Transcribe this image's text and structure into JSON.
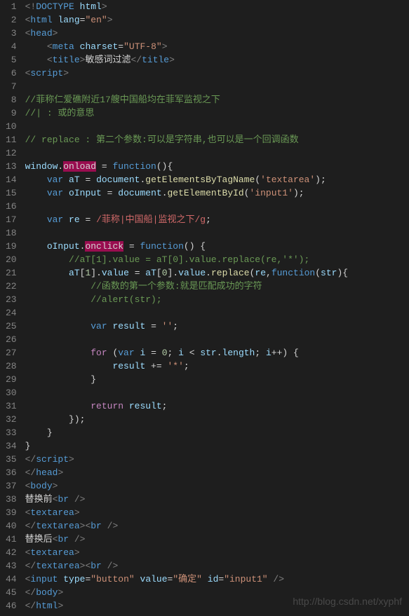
{
  "lineCount": 46,
  "watermark": "http://blog.csdn.net/xyphf",
  "tokens": {
    "l1": [
      [
        "t-gray",
        "<!"
      ],
      [
        "t-blue",
        "DOCTYPE"
      ],
      [
        "t-white",
        " "
      ],
      [
        "t-attr",
        "html"
      ],
      [
        "t-gray",
        ">"
      ]
    ],
    "l2": [
      [
        "t-gray",
        "<"
      ],
      [
        "t-blue",
        "html"
      ],
      [
        "t-white",
        " "
      ],
      [
        "t-attr",
        "lang"
      ],
      [
        "t-white",
        "="
      ],
      [
        "t-str",
        "\"en\""
      ],
      [
        "t-gray",
        ">"
      ]
    ],
    "l3": [
      [
        "t-gray",
        "<"
      ],
      [
        "t-blue",
        "head"
      ],
      [
        "t-gray",
        ">"
      ]
    ],
    "l4": [
      [
        "t-white",
        "    "
      ],
      [
        "t-gray",
        "<"
      ],
      [
        "t-blue",
        "meta"
      ],
      [
        "t-white",
        " "
      ],
      [
        "t-attr",
        "charset"
      ],
      [
        "t-white",
        "="
      ],
      [
        "t-str",
        "\"UTF-8\""
      ],
      [
        "t-gray",
        ">"
      ]
    ],
    "l5": [
      [
        "t-white",
        "    "
      ],
      [
        "t-gray",
        "<"
      ],
      [
        "t-blue",
        "title"
      ],
      [
        "t-gray",
        ">"
      ],
      [
        "t-white",
        "敏感词过滤"
      ],
      [
        "t-gray",
        "</"
      ],
      [
        "t-blue",
        "title"
      ],
      [
        "t-gray",
        ">"
      ]
    ],
    "l6": [
      [
        "t-gray",
        "<"
      ],
      [
        "t-blue",
        "script"
      ],
      [
        "t-gray",
        ">"
      ]
    ],
    "l7": [],
    "l8": [
      [
        "t-cmt",
        "//菲称仁爱礁附近17艘中国船均在菲军监视之下"
      ]
    ],
    "l9": [
      [
        "t-cmt",
        "//| : 或的意思"
      ]
    ],
    "l10": [],
    "l11": [
      [
        "t-cmt",
        "// replace : 第二个参数:可以是字符串,也可以是一个回调函数"
      ]
    ],
    "l12": [],
    "l13": [
      [
        "t-lblue",
        "window"
      ],
      [
        "t-white",
        "."
      ],
      [
        "hl",
        "onload"
      ],
      [
        "t-white",
        " = "
      ],
      [
        "t-kw",
        "function"
      ],
      [
        "t-white",
        "(){"
      ]
    ],
    "l14": [
      [
        "t-white",
        "    "
      ],
      [
        "t-kw",
        "var"
      ],
      [
        "t-white",
        " "
      ],
      [
        "t-lblue",
        "aT"
      ],
      [
        "t-white",
        " = "
      ],
      [
        "t-lblue",
        "document"
      ],
      [
        "t-white",
        "."
      ],
      [
        "t-func",
        "getElementsByTagName"
      ],
      [
        "t-white",
        "("
      ],
      [
        "t-str",
        "'textarea'"
      ],
      [
        "t-white",
        ");"
      ]
    ],
    "l15": [
      [
        "t-white",
        "    "
      ],
      [
        "t-kw",
        "var"
      ],
      [
        "t-white",
        " "
      ],
      [
        "t-lblue",
        "oInput"
      ],
      [
        "t-white",
        " = "
      ],
      [
        "t-lblue",
        "document"
      ],
      [
        "t-white",
        "."
      ],
      [
        "t-func",
        "getElementById"
      ],
      [
        "t-white",
        "("
      ],
      [
        "t-str",
        "'input1'"
      ],
      [
        "t-white",
        ");"
      ]
    ],
    "l16": [],
    "l17": [
      [
        "t-white",
        "    "
      ],
      [
        "t-kw",
        "var"
      ],
      [
        "t-white",
        " "
      ],
      [
        "t-lblue",
        "re"
      ],
      [
        "t-white",
        " = "
      ],
      [
        "t-regex",
        "/菲称|中国船|监视之下/g"
      ],
      [
        "t-white",
        ";"
      ]
    ],
    "l18": [],
    "l19": [
      [
        "t-white",
        "    "
      ],
      [
        "t-lblue",
        "oInput"
      ],
      [
        "t-white",
        "."
      ],
      [
        "hl",
        "onclick"
      ],
      [
        "t-white",
        " = "
      ],
      [
        "t-kw",
        "function"
      ],
      [
        "t-white",
        "() {"
      ]
    ],
    "l20": [
      [
        "t-white",
        "        "
      ],
      [
        "t-cmt",
        "//aT[1].value = aT[0].value.replace(re,'*');"
      ]
    ],
    "l21": [
      [
        "t-white",
        "        "
      ],
      [
        "t-lblue",
        "aT"
      ],
      [
        "t-white",
        "["
      ],
      [
        "t-num",
        "1"
      ],
      [
        "t-white",
        "]."
      ],
      [
        "t-lblue",
        "value"
      ],
      [
        "t-white",
        " = "
      ],
      [
        "t-lblue",
        "aT"
      ],
      [
        "t-white",
        "["
      ],
      [
        "t-num",
        "0"
      ],
      [
        "t-white",
        "]."
      ],
      [
        "t-lblue",
        "value"
      ],
      [
        "t-white",
        "."
      ],
      [
        "t-func",
        "replace"
      ],
      [
        "t-white",
        "("
      ],
      [
        "t-lblue",
        "re"
      ],
      [
        "t-white",
        ","
      ],
      [
        "t-kw",
        "function"
      ],
      [
        "t-white",
        "("
      ],
      [
        "t-lblue",
        "str"
      ],
      [
        "t-white",
        "){"
      ]
    ],
    "l22": [
      [
        "t-white",
        "            "
      ],
      [
        "t-cmt",
        "//函数的第一个参数:就是匹配成功的字符"
      ]
    ],
    "l23": [
      [
        "t-white",
        "            "
      ],
      [
        "t-cmt",
        "//alert(str);"
      ]
    ],
    "l24": [],
    "l25": [
      [
        "t-white",
        "            "
      ],
      [
        "t-kw",
        "var"
      ],
      [
        "t-white",
        " "
      ],
      [
        "t-lblue",
        "result"
      ],
      [
        "t-white",
        " = "
      ],
      [
        "t-str",
        "''"
      ],
      [
        "t-white",
        ";"
      ]
    ],
    "l26": [],
    "l27": [
      [
        "t-white",
        "            "
      ],
      [
        "t-ctrl",
        "for"
      ],
      [
        "t-white",
        " ("
      ],
      [
        "t-kw",
        "var"
      ],
      [
        "t-white",
        " "
      ],
      [
        "t-lblue",
        "i"
      ],
      [
        "t-white",
        " = "
      ],
      [
        "t-num",
        "0"
      ],
      [
        "t-white",
        "; "
      ],
      [
        "t-lblue",
        "i"
      ],
      [
        "t-white",
        " < "
      ],
      [
        "t-lblue",
        "str"
      ],
      [
        "t-white",
        "."
      ],
      [
        "t-lblue",
        "length"
      ],
      [
        "t-white",
        "; "
      ],
      [
        "t-lblue",
        "i"
      ],
      [
        "t-white",
        "++) {"
      ]
    ],
    "l28": [
      [
        "t-white",
        "                "
      ],
      [
        "t-lblue",
        "result"
      ],
      [
        "t-white",
        " += "
      ],
      [
        "t-str",
        "'*'"
      ],
      [
        "t-white",
        ";"
      ]
    ],
    "l29": [
      [
        "t-white",
        "            }"
      ]
    ],
    "l30": [],
    "l31": [
      [
        "t-white",
        "            "
      ],
      [
        "t-ctrl",
        "return"
      ],
      [
        "t-white",
        " "
      ],
      [
        "t-lblue",
        "result"
      ],
      [
        "t-white",
        ";"
      ]
    ],
    "l32": [
      [
        "t-white",
        "        });"
      ]
    ],
    "l33": [
      [
        "t-white",
        "    }"
      ]
    ],
    "l34": [
      [
        "t-white",
        "}"
      ]
    ],
    "l35": [
      [
        "t-gray",
        "</"
      ],
      [
        "t-blue",
        "script"
      ],
      [
        "t-gray",
        ">"
      ]
    ],
    "l36": [
      [
        "t-gray",
        "</"
      ],
      [
        "t-blue",
        "head"
      ],
      [
        "t-gray",
        ">"
      ]
    ],
    "l37": [
      [
        "t-gray",
        "<"
      ],
      [
        "t-blue",
        "body"
      ],
      [
        "t-gray",
        ">"
      ]
    ],
    "l38": [
      [
        "t-white",
        "替换前"
      ],
      [
        "t-gray",
        "<"
      ],
      [
        "t-blue",
        "br"
      ],
      [
        "t-white",
        " "
      ],
      [
        "t-gray",
        "/>"
      ]
    ],
    "l39": [
      [
        "t-gray",
        "<"
      ],
      [
        "t-blue",
        "textarea"
      ],
      [
        "t-gray",
        ">"
      ]
    ],
    "l40": [
      [
        "t-gray",
        "</"
      ],
      [
        "t-blue",
        "textarea"
      ],
      [
        "t-gray",
        "><"
      ],
      [
        "t-blue",
        "br"
      ],
      [
        "t-white",
        " "
      ],
      [
        "t-gray",
        "/>"
      ]
    ],
    "l41": [
      [
        "t-white",
        "替换后"
      ],
      [
        "t-gray",
        "<"
      ],
      [
        "t-blue",
        "br"
      ],
      [
        "t-white",
        " "
      ],
      [
        "t-gray",
        "/>"
      ]
    ],
    "l42": [
      [
        "t-gray",
        "<"
      ],
      [
        "t-blue",
        "textarea"
      ],
      [
        "t-gray",
        ">"
      ]
    ],
    "l43": [
      [
        "t-gray",
        "</"
      ],
      [
        "t-blue",
        "textarea"
      ],
      [
        "t-gray",
        "><"
      ],
      [
        "t-blue",
        "br"
      ],
      [
        "t-white",
        " "
      ],
      [
        "t-gray",
        "/>"
      ]
    ],
    "l44": [
      [
        "t-gray",
        "<"
      ],
      [
        "t-blue",
        "input"
      ],
      [
        "t-white",
        " "
      ],
      [
        "t-attr",
        "type"
      ],
      [
        "t-white",
        "="
      ],
      [
        "t-str",
        "\"button\""
      ],
      [
        "t-white",
        " "
      ],
      [
        "t-attr",
        "value"
      ],
      [
        "t-white",
        "="
      ],
      [
        "t-str",
        "\"确定\""
      ],
      [
        "t-white",
        " "
      ],
      [
        "t-attr",
        "id"
      ],
      [
        "t-white",
        "="
      ],
      [
        "t-str",
        "\"input1\""
      ],
      [
        "t-white",
        " "
      ],
      [
        "t-gray",
        "/>"
      ]
    ],
    "l45": [
      [
        "t-gray",
        "</"
      ],
      [
        "t-blue",
        "body"
      ],
      [
        "t-gray",
        ">"
      ]
    ],
    "l46": [
      [
        "t-gray",
        "</"
      ],
      [
        "t-blue",
        "html"
      ],
      [
        "t-gray",
        ">"
      ]
    ]
  }
}
